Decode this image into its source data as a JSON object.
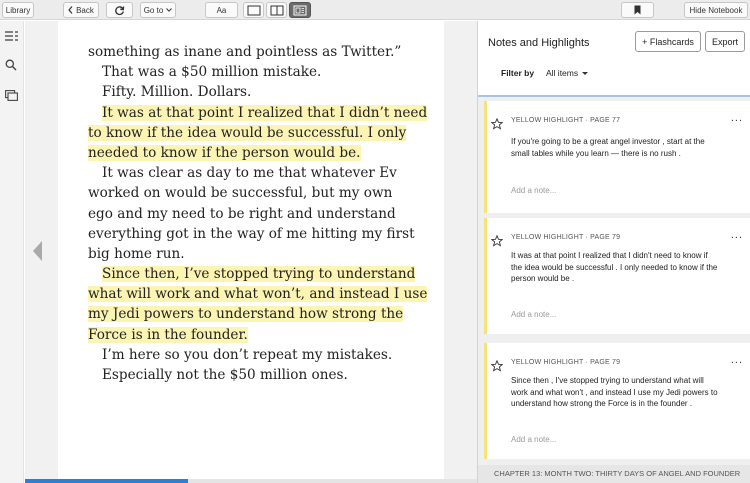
{
  "toolbar": {
    "library_label": "Library",
    "back_label": "Back",
    "goto_label": "Go to",
    "font_label": "Aa",
    "bookmark_icon": "bookmark-icon",
    "hide_notebook_label": "Hide Notebook"
  },
  "reader": {
    "lines": [
      {
        "text": "something as inane and pointless as Twitter.”",
        "highlight": false,
        "indent": false
      },
      {
        "text": "That was a $50 million mistake.",
        "highlight": false,
        "indent": true
      },
      {
        "text": "Fifty. Million. Dollars.",
        "highlight": false,
        "indent": true
      },
      {
        "text": "It was at that point I realized that I didn’t need",
        "highlight": true,
        "indent": true
      },
      {
        "text": "to know if the idea would be successful. I only",
        "highlight": true,
        "indent": false
      },
      {
        "text": "needed to know if the person would be.",
        "highlight": true,
        "indent": false
      },
      {
        "text": "It was clear as day to me that whatever Ev",
        "highlight": false,
        "indent": true
      },
      {
        "text": "worked on would be successful, but my own",
        "highlight": false,
        "indent": false
      },
      {
        "text": "ego and my need to be right and understand",
        "highlight": false,
        "indent": false
      },
      {
        "text": "everything got in the way of me hitting my first",
        "highlight": false,
        "indent": false
      },
      {
        "text": "big home run.",
        "highlight": false,
        "indent": false
      },
      {
        "text": "Since then, I’ve stopped trying to understand",
        "highlight": true,
        "indent": true
      },
      {
        "text": "what will work and what won’t, and instead I use",
        "highlight": true,
        "indent": false
      },
      {
        "text": "my Jedi powers to understand how strong the",
        "highlight": true,
        "indent": false
      },
      {
        "text": "Force is in the founder.",
        "highlight": true,
        "indent": false
      },
      {
        "text": "I’m here so you don’t repeat my mistakes.",
        "highlight": false,
        "indent": true
      },
      {
        "text": "Especially not the $50 million ones.",
        "highlight": false,
        "indent": true
      }
    ],
    "progress_fraction": 0.36
  },
  "notebook": {
    "title": "Notes and Highlights",
    "flashcards_label": "+ Flashcards",
    "export_label": "Export",
    "filter_label": "Filter by",
    "filter_value": "All items",
    "cards": [
      {
        "header": "YELLOW HIGHLIGHT · PAGE 77",
        "text": "If you're going to be a great angel investor , start at the small tables while you learn — there is no rush .",
        "note_placeholder": "Add a note...",
        "more": "..."
      },
      {
        "header": "YELLOW HIGHLIGHT · PAGE 79",
        "text": "It was at that point I realized that I didn't need to know if the idea would be successful . I only needed to know if the person would be .",
        "note_placeholder": "Add a note...",
        "more": "..."
      },
      {
        "header": "YELLOW HIGHLIGHT · PAGE 79",
        "text": "Since then , I've stopped trying to understand what will work and what won't , and instead I use my Jedi powers to understand how strong the Force is in the founder .",
        "note_placeholder": "Add a note...",
        "more": "..."
      }
    ],
    "chapter_footer": "CHAPTER 13: MONTH TWO: THIRTY DAYS OF ANGEL AND FOUNDER"
  },
  "colors": {
    "highlight": "#fbf4b3",
    "highlight_bar": "#f4e27a",
    "progress": "#2d7fd1"
  }
}
